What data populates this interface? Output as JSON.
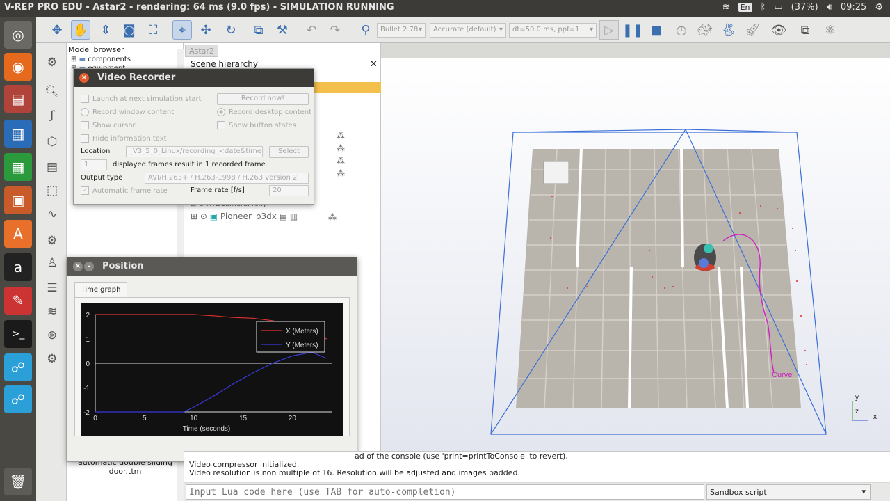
{
  "window_title": "V-REP PRO EDU - Astar2 - rendering: 64 ms (9.0 fps) - SIMULATION RUNNING",
  "tray": {
    "lang": "En",
    "battery": "(37%)",
    "time": "09:25"
  },
  "toolbar": {
    "engine": "Bullet 2.78",
    "accuracy": "Accurate (default)",
    "timestep": "dt=50.0 ms, ppf=1"
  },
  "model_browser": {
    "title": "Model browser",
    "items": [
      "components",
      "equipment"
    ],
    "bottom_item": "automatic double sliding door.ttm"
  },
  "scene": {
    "tab": "Astar2",
    "hierarchy_title": "Scene hierarchy",
    "items": [
      "XYZCameraProxy",
      "Pioneer_p3dx"
    ]
  },
  "video_recorder": {
    "title": "Video Recorder",
    "launch_next": "Launch at next simulation start",
    "record_now": "Record now!",
    "record_window": "Record window content",
    "record_desktop": "Record desktop content",
    "show_cursor": "Show cursor",
    "show_buttons": "Show button states",
    "hide_info": "Hide information text",
    "location_label": "Location",
    "location_value": "_V3_5_0_Linux/recording_<date&time>.*",
    "select": "Select",
    "frames_value": "1",
    "frames_text": "displayed frames result in 1 recorded frame",
    "output_label": "Output type",
    "output_value": "AVI/H.263+ / H.263-1998 / H.263 version 2",
    "auto_rate": "Automatic frame rate",
    "frame_rate_label": "Frame rate [f/s]",
    "frame_rate_value": "20"
  },
  "position_dialog": {
    "title": "Position",
    "tab": "Time graph"
  },
  "chart_data": {
    "type": "line",
    "xlabel": "Time (seconds)",
    "ylabel": "",
    "xlim": [
      0,
      24
    ],
    "ylim": [
      -2,
      2
    ],
    "x_ticks": [
      "0",
      "5",
      "10",
      "15",
      "20"
    ],
    "y_ticks": [
      "2",
      "1",
      "0",
      "-1",
      "-2"
    ],
    "legend": "top-right",
    "series": [
      {
        "name": "X (Meters)",
        "color": "#e03030",
        "points": [
          [
            0,
            2.0
          ],
          [
            5,
            2.0
          ],
          [
            10,
            2.0
          ],
          [
            12,
            1.95
          ],
          [
            14,
            1.88
          ],
          [
            16,
            1.85
          ],
          [
            18,
            1.75
          ],
          [
            20,
            1.55
          ],
          [
            22,
            1.2
          ],
          [
            23.5,
            1.0
          ]
        ]
      },
      {
        "name": "Y (Meters)",
        "color": "#3838d8",
        "points": [
          [
            0,
            -2.0
          ],
          [
            5,
            -2.0
          ],
          [
            9,
            -2.0
          ],
          [
            10,
            -1.8
          ],
          [
            12,
            -1.35
          ],
          [
            14,
            -0.85
          ],
          [
            16,
            -0.4
          ],
          [
            18,
            0.0
          ],
          [
            20,
            0.3
          ],
          [
            22,
            0.45
          ],
          [
            23.5,
            0.2
          ]
        ]
      }
    ]
  },
  "curve_label": "Curve",
  "console": {
    "line1": "ad of the console (use 'print=printToConsole' to revert).",
    "line2": "Video compressor initialized.",
    "line3": "Video resolution is non multiple of 16. Resolution will be adjusted and images padded.",
    "input_placeholder": "Input Lua code here (use TAB for auto-completion)",
    "script_select": "Sandbox script"
  }
}
